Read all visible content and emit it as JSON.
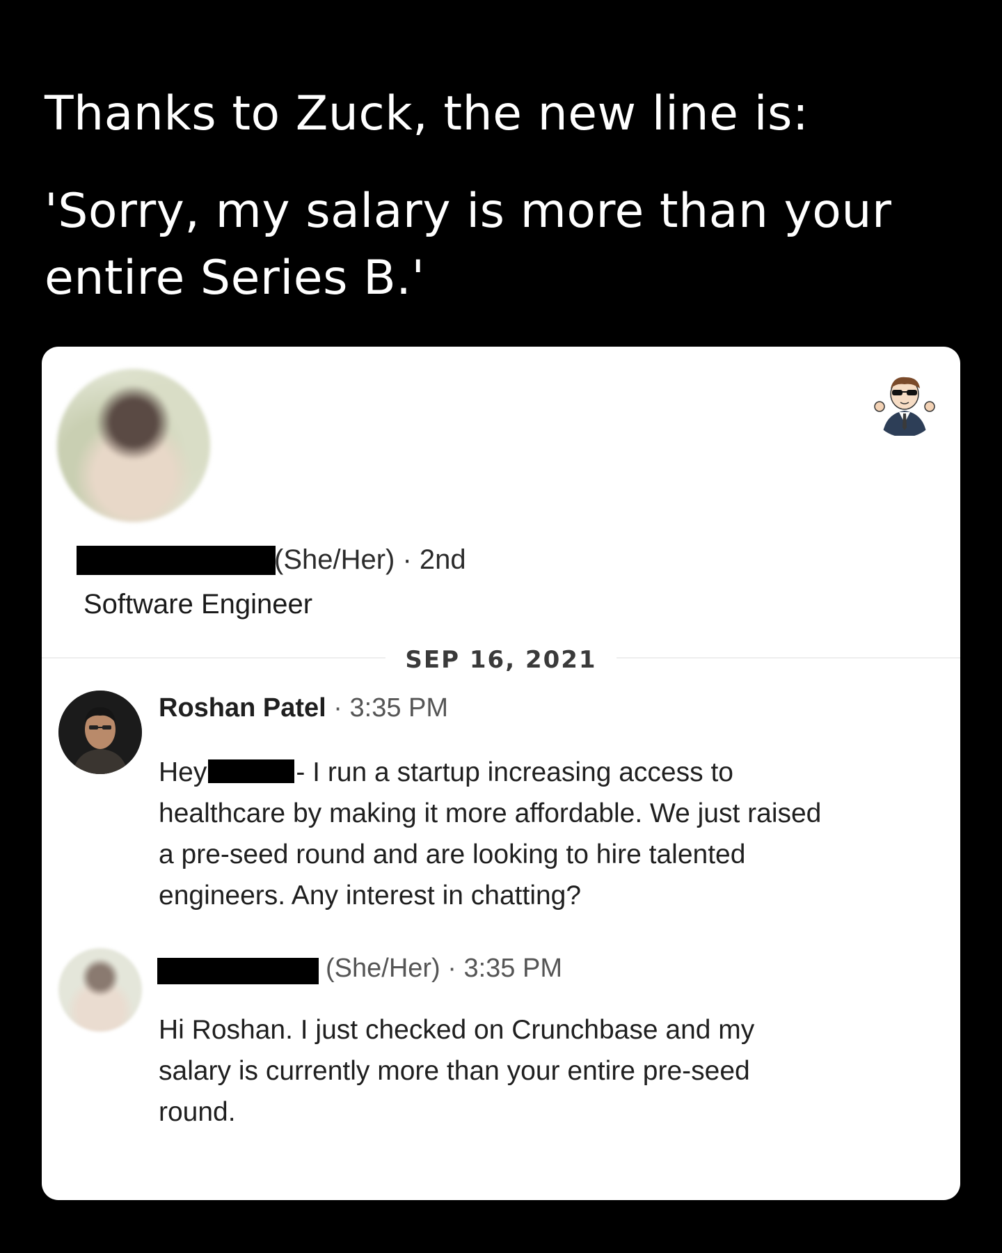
{
  "headline": {
    "line1": "Thanks to Zuck, the new line is:",
    "line2": "'Sorry, my salary is more than your entire Series B.'"
  },
  "profile": {
    "pronouns_degree": "(She/Her) · 2nd",
    "title": "Software Engineer"
  },
  "conversation": {
    "date": "SEP 16, 2021",
    "messages": [
      {
        "sender": "Roshan Patel",
        "time": "· 3:35 PM",
        "text_before_redaction": "Hey",
        "text_after_redaction": "- I run a startup increasing access to healthcare by making it more affordable. We just raised a pre-seed round and are looking to hire talented engineers. Any interest in chatting?"
      },
      {
        "sender_pronouns_time": "(She/Her) · 3:35 PM",
        "text": "Hi Roshan. I just checked on Crunchbase and my salary is currently more than your entire pre-seed round."
      }
    ]
  },
  "icons": {
    "corner_badge": "cartoon-mascot-icon",
    "profile_photo": "blurred-profile-photo",
    "sender_photo": "sender-profile-photo"
  }
}
